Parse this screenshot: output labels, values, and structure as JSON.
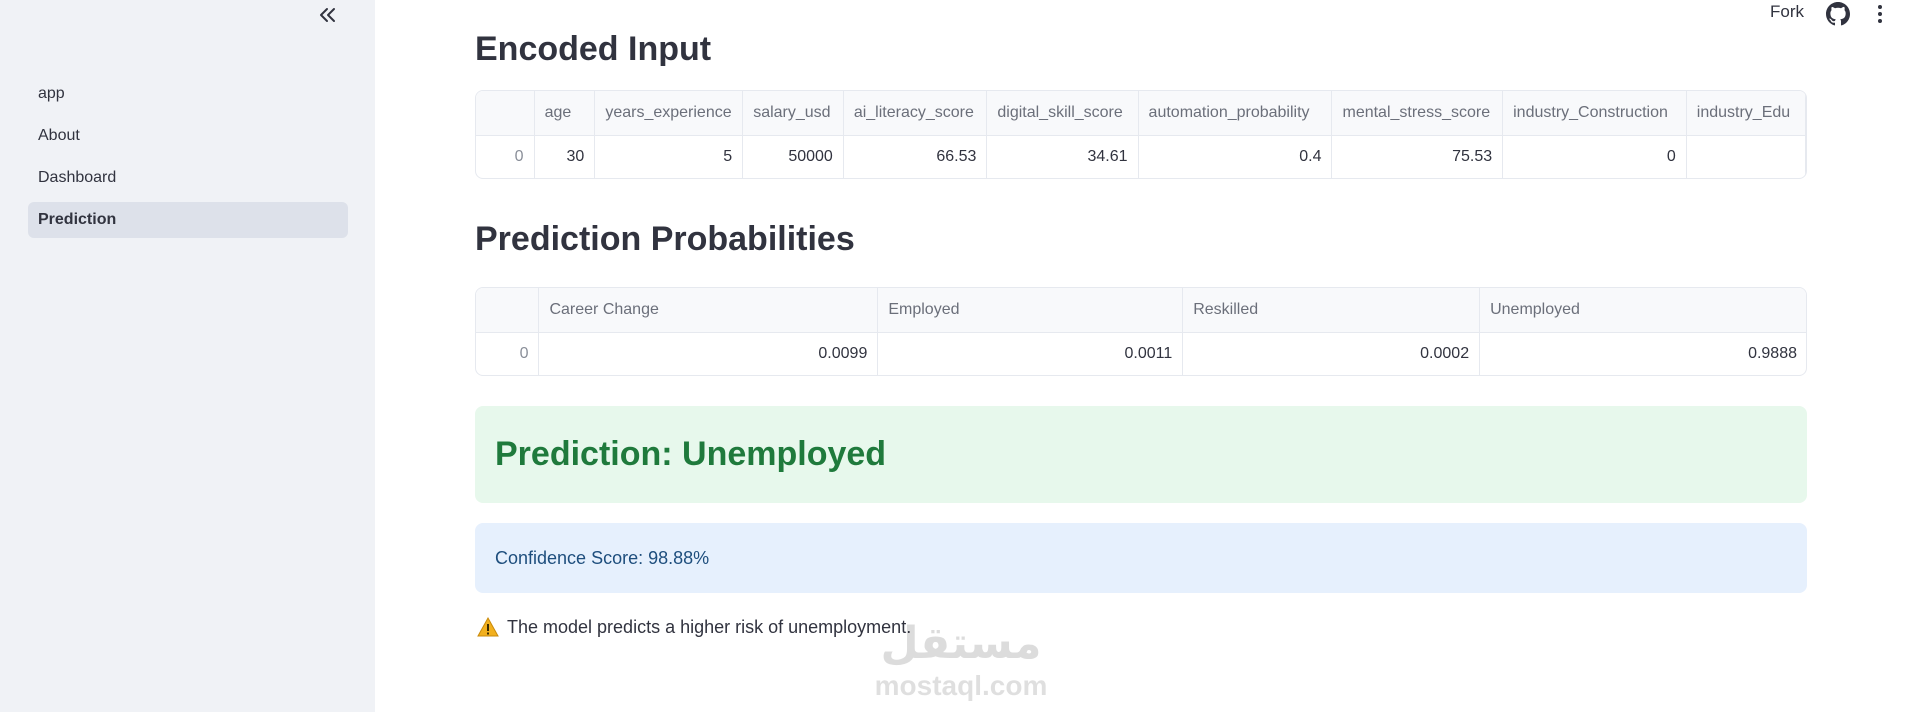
{
  "sidebar": {
    "items": [
      {
        "label": "app",
        "active": false
      },
      {
        "label": "About",
        "active": false
      },
      {
        "label": "Dashboard",
        "active": false
      },
      {
        "label": "Prediction",
        "active": true
      }
    ]
  },
  "header": {
    "fork_label": "Fork",
    "collapse_icon": "double-chevron-left-icon",
    "github_icon": "github-icon",
    "menu_icon": "kebab-menu-icon"
  },
  "encoded_input": {
    "heading": "Encoded Input",
    "columns": [
      "",
      "age",
      "years_experience",
      "salary_usd",
      "ai_literacy_score",
      "digital_skill_score",
      "automation_probability",
      "mental_stress_score",
      "industry_Construction",
      "industry_Edu"
    ],
    "rows": [
      [
        "0",
        "30",
        "5",
        "50000",
        "66.53",
        "34.61",
        "0.4",
        "75.53",
        "0",
        ""
      ]
    ]
  },
  "probabilities": {
    "heading": "Prediction Probabilities",
    "columns": [
      "",
      "Career Change",
      "Employed",
      "Reskilled",
      "Unemployed"
    ],
    "rows": [
      [
        "0",
        "0.0099",
        "0.0011",
        "0.0002",
        "0.9888"
      ]
    ]
  },
  "result": {
    "prediction_text": "Prediction: Unemployed",
    "confidence_text": "Confidence Score: 98.88%",
    "warning_text": "The model predicts a higher risk of unemployment.",
    "warning_icon": "warning-triangle-icon"
  },
  "watermark": {
    "logo_text": "مستقل",
    "text": "mostaql.com"
  },
  "colors": {
    "sidebar_bg": "#f0f2f6",
    "success_bg": "#e7f8ec",
    "success_text": "#1f7a3c",
    "info_bg": "#e6f0fd",
    "info_text": "#1e4e7d"
  }
}
